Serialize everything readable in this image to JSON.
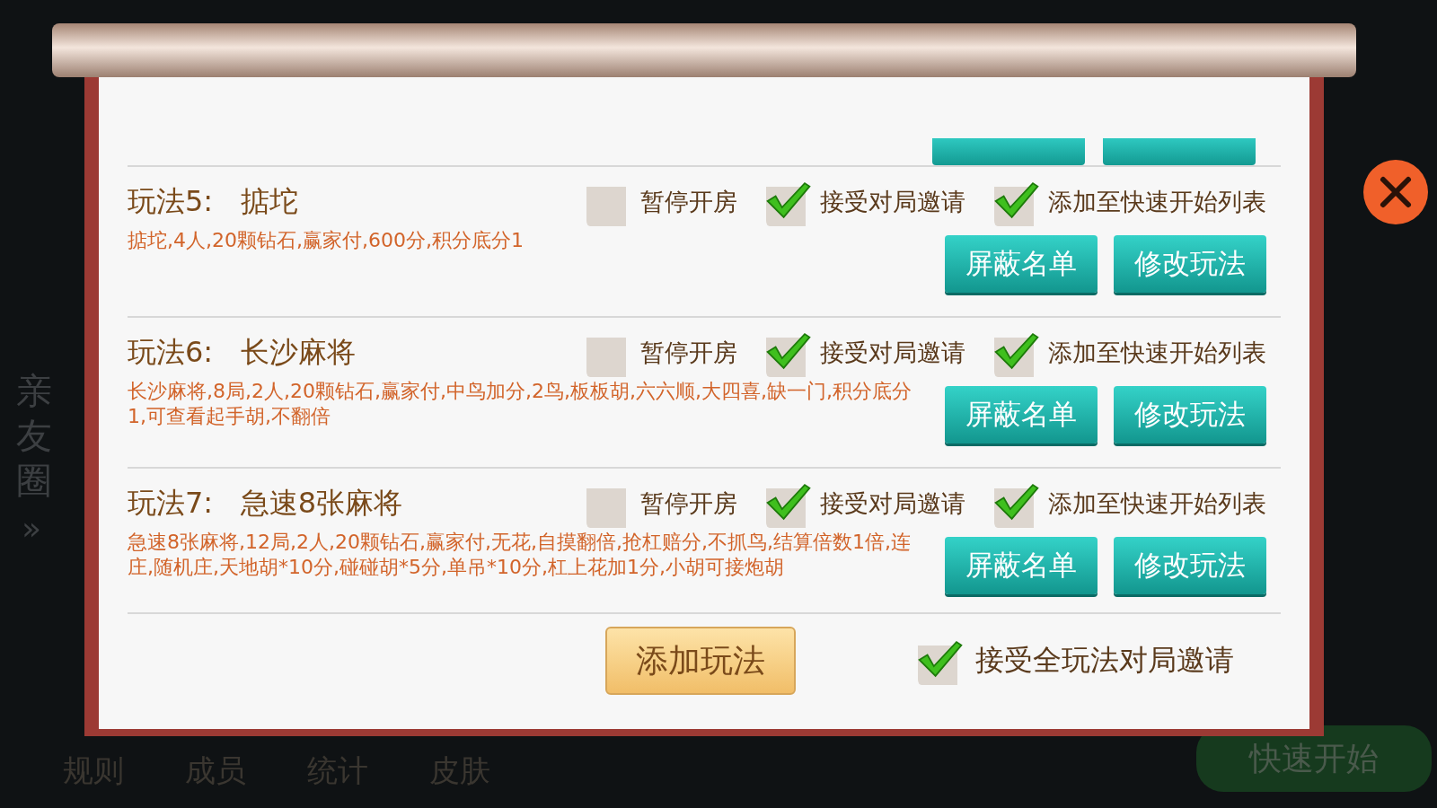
{
  "background": {
    "side_label": "亲友圈",
    "side_arrow": "»",
    "bottom_tabs": [
      "规则",
      "成员",
      "统计",
      "皮肤"
    ],
    "quick_start": "快速开始"
  },
  "modes": [
    {
      "title": "玩法5:",
      "name": "掂坨",
      "description": "掂坨,4人,20颗钻石,赢家付,600分,积分底分1",
      "options": [
        {
          "label": "暂停开房",
          "checked": false
        },
        {
          "label": "接受对局邀请",
          "checked": true
        },
        {
          "label": "添加至快速开始列表",
          "checked": true
        }
      ],
      "buttons": [
        "屏蔽名单",
        "修改玩法"
      ]
    },
    {
      "title": "玩法6:",
      "name": "长沙麻将",
      "description": "长沙麻将,8局,2人,20颗钻石,赢家付,中鸟加分,2鸟,板板胡,六六顺,大四喜,缺一门,积分底分1,可查看起手胡,不翻倍",
      "options": [
        {
          "label": "暂停开房",
          "checked": false
        },
        {
          "label": "接受对局邀请",
          "checked": true
        },
        {
          "label": "添加至快速开始列表",
          "checked": true
        }
      ],
      "buttons": [
        "屏蔽名单",
        "修改玩法"
      ]
    },
    {
      "title": "玩法7:",
      "name": "急速8张麻将",
      "description": "急速8张麻将,12局,2人,20颗钻石,赢家付,无花,自摸翻倍,抢杠赔分,不抓鸟,结算倍数1倍,连庄,随机庄,天地胡*10分,碰碰胡*5分,单吊*10分,杠上花加1分,小胡可接炮胡",
      "options": [
        {
          "label": "暂停开房",
          "checked": false
        },
        {
          "label": "接受对局邀请",
          "checked": true
        },
        {
          "label": "添加至快速开始列表",
          "checked": true
        }
      ],
      "buttons": [
        "屏蔽名单",
        "修改玩法"
      ]
    }
  ],
  "add_button": "添加玩法",
  "accept_all": {
    "label": "接受全玩法对局邀请",
    "checked": true
  }
}
